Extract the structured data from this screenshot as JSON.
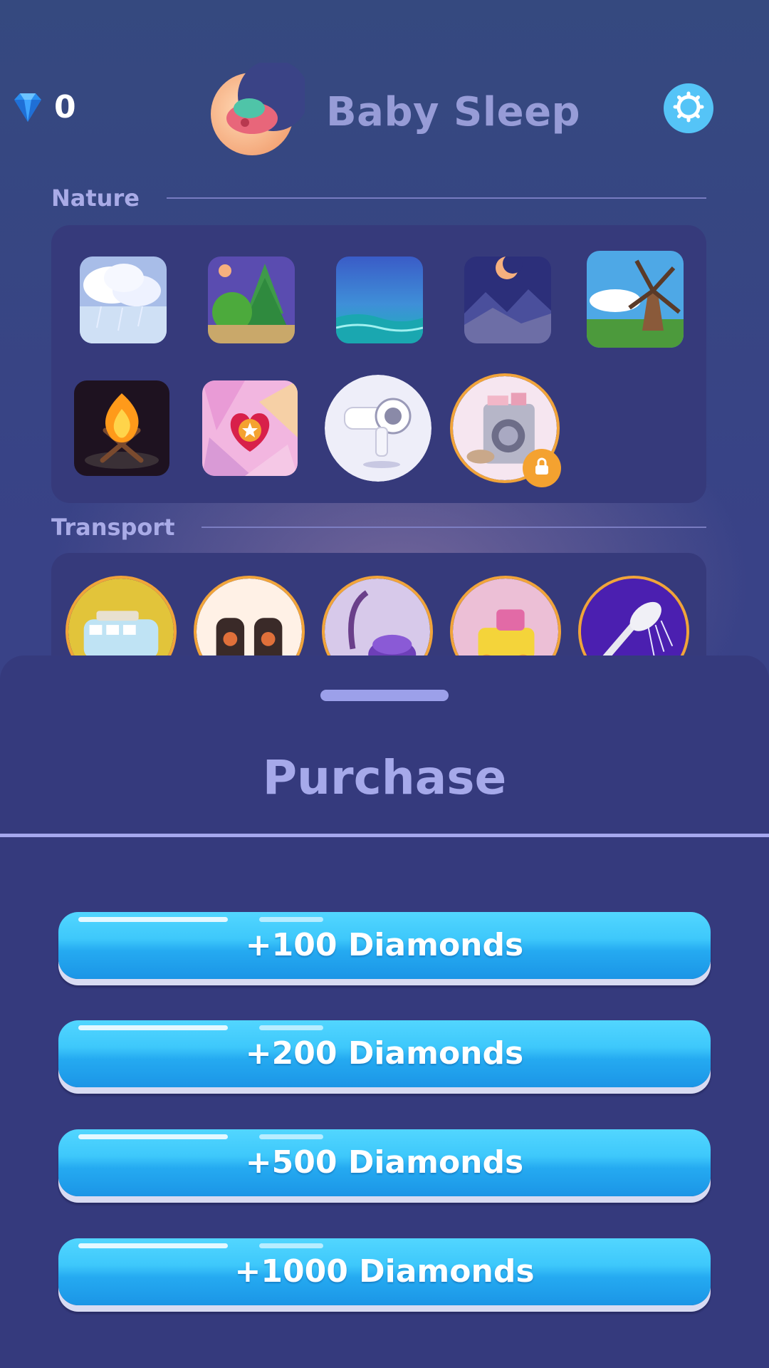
{
  "header": {
    "diamond_count": "0",
    "app_title": "Baby Sleep",
    "icons": {
      "diamond": "diamond-icon",
      "settings": "gear-icon",
      "logo": "moon-baby-logo"
    }
  },
  "sections": [
    {
      "title": "Nature",
      "items": [
        {
          "name": "rain-clouds",
          "style": "square"
        },
        {
          "name": "forest-night",
          "style": "square"
        },
        {
          "name": "ocean",
          "style": "square"
        },
        {
          "name": "night-mountains",
          "style": "square"
        },
        {
          "name": "windmill",
          "style": "square"
        },
        {
          "name": "campfire",
          "style": "square"
        },
        {
          "name": "heartbeat",
          "style": "square"
        },
        {
          "name": "hair-dryer",
          "style": "round"
        },
        {
          "name": "washing-machine",
          "style": "round",
          "locked": true
        }
      ]
    },
    {
      "title": "Transport",
      "items": [
        {
          "name": "camper-van",
          "style": "round",
          "locked": true
        },
        {
          "name": "speakers",
          "style": "round",
          "locked": true
        },
        {
          "name": "vacuum-cleaner",
          "style": "round",
          "locked": true
        },
        {
          "name": "toy-train",
          "style": "round",
          "locked": true
        },
        {
          "name": "shower",
          "style": "round",
          "locked": true
        }
      ]
    }
  ],
  "purchase_sheet": {
    "title": "Purchase",
    "options": [
      "+100 Diamonds",
      "+200 Diamonds",
      "+500 Diamonds",
      "+1000 Diamonds"
    ]
  },
  "colors": {
    "accent": "#3ec8fb",
    "title_text": "#a9abe7",
    "panel": "#363a7b",
    "sheet": "#353a7d",
    "badge": "#f4a230"
  }
}
